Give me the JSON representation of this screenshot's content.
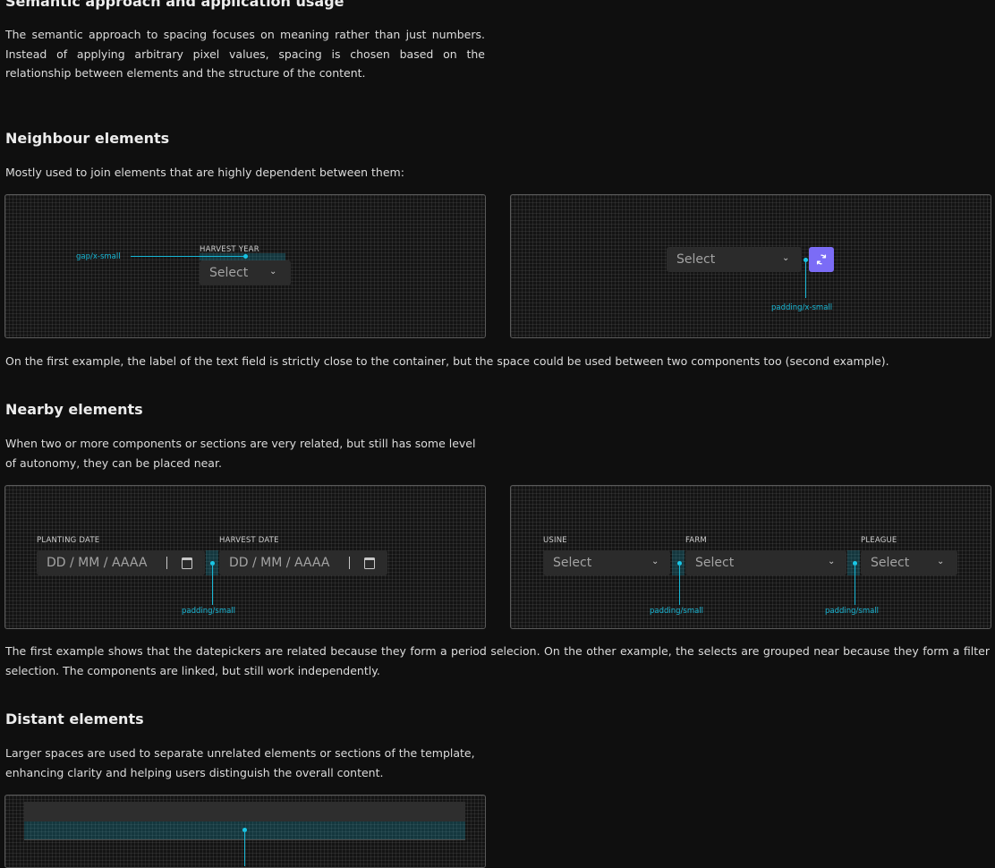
{
  "sections": {
    "semantic": {
      "title": "Semantic approach and application usage",
      "body": "The semantic approach to spacing focuses on meaning rather than just numbers. Instead of applying arbitrary pixel values, spacing is chosen based on the relationship between elements and the structure of the content."
    },
    "neighbour": {
      "title": "Neighbour elements",
      "intro": "Mostly used to join elements that are highly dependent between them:",
      "example1": {
        "field_label": "HARVEST YEAR",
        "select_value": "Select",
        "annotation": "gap/x-small"
      },
      "example2": {
        "select_value": "Select",
        "annotation": "padding/x-small"
      },
      "caption": "On the first example, the label of the text field is strictly close to the container, but the space could be used between two components too (second example)."
    },
    "nearby": {
      "title": "Nearby elements",
      "intro": "When two or more components or sections are very related, but still has some level of autonomy, they can be placed near.",
      "example1": {
        "planting_label": "PLANTING DATE",
        "harvest_label": "HARVEST DATE",
        "date_placeholder": "DD / MM / AAAA",
        "annotation": "padding/small"
      },
      "example2": {
        "usine_label": "USINE",
        "farm_label": "FARM",
        "pleague_label": "PLEAGUE",
        "select_value": "Select",
        "annotation": "padding/small"
      },
      "caption": "The first example shows that the datepickers are related because they form a period selecion. On the other example, the selects are grouped near because they form a filter selection. The components are linked, but still work independently."
    },
    "distant": {
      "title": "Distant elements",
      "intro": "Larger spaces are used to separate unrelated elements or sections of the template, enhancing clarity and helping users distinguish the overall content."
    }
  },
  "colors": {
    "accent_cyan": "#19b8d6",
    "icon_button": "#7b6cf6",
    "background": "#0f0f0f"
  },
  "icons": {
    "chevron": "chevron-down-icon",
    "calendar": "calendar-icon",
    "refresh": "refresh-icon"
  }
}
